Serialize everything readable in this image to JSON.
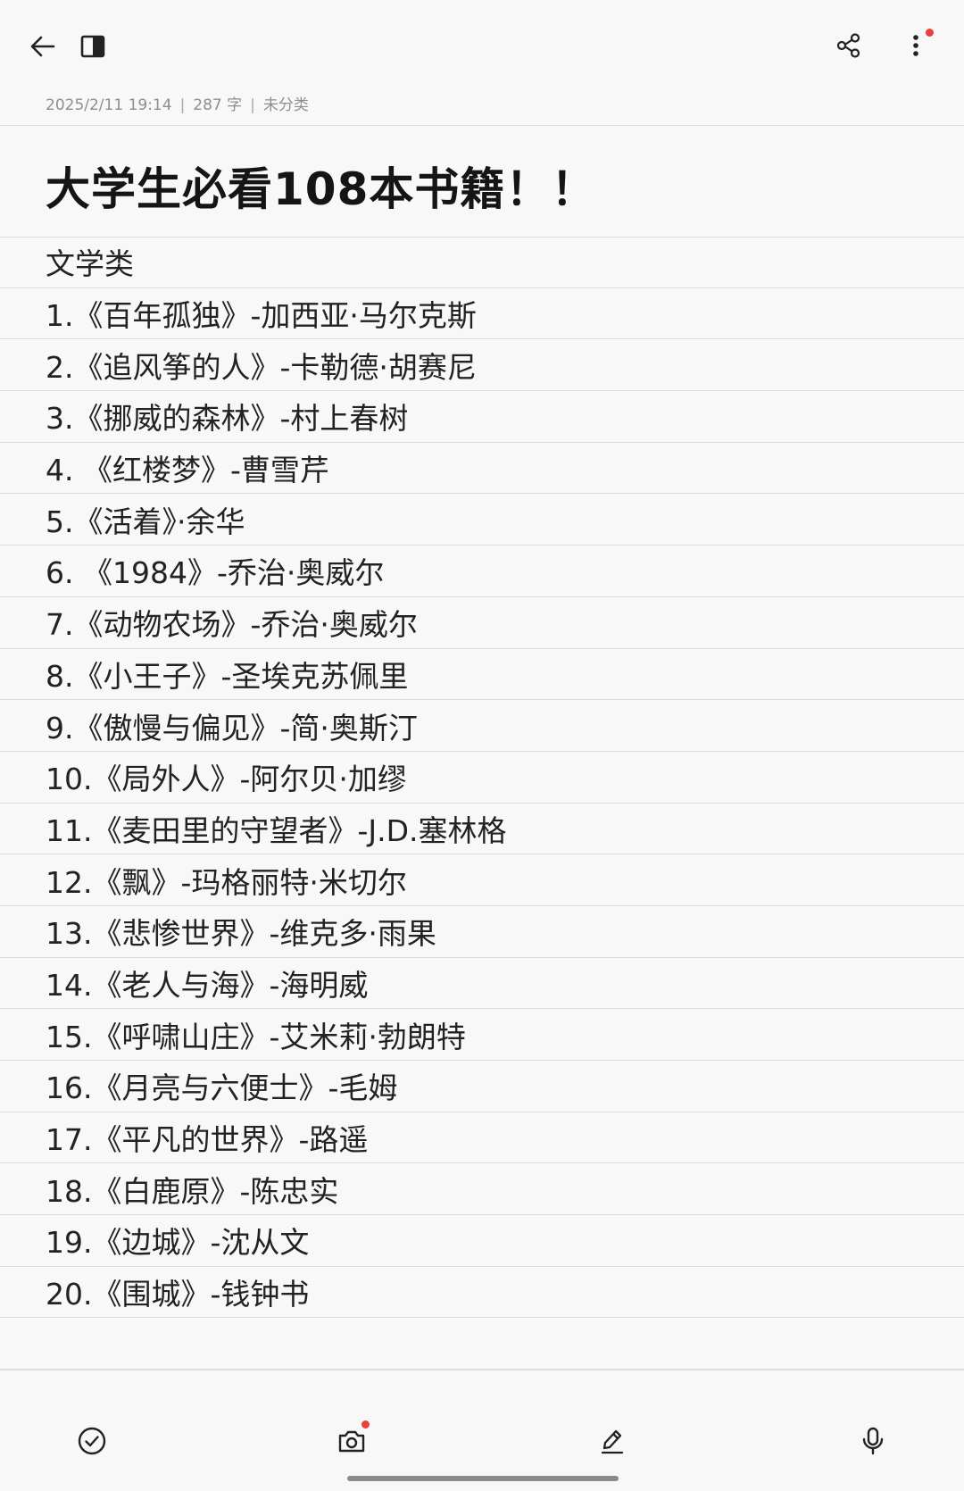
{
  "note": {
    "meta": {
      "datetime": "2025/2/11 19:14",
      "word_count": "287 字",
      "category": "未分类",
      "separator": "|"
    },
    "title": "大学生必看108本书籍！！",
    "lines": [
      "文学类",
      "1.《百年孤独》-加西亚·马尔克斯",
      "2.《追风筝的人》-卡勒德·胡赛尼",
      "3.《挪威的森林》-村上春树",
      "4. 《红楼梦》-曹雪芹",
      "5.《活着》·余华",
      "6. 《1984》-乔治·奥威尔",
      "7.《动物农场》-乔治·奥威尔",
      "8.《小王子》-圣埃克苏佩里",
      "9.《傲慢与偏见》-简·奥斯汀",
      "10.《局外人》-阿尔贝·加缪",
      "11.《麦田里的守望者》-J.D.塞林格",
      "12.《飘》-玛格丽特·米切尔",
      "13.《悲惨世界》-维克多·雨果",
      "14.《老人与海》-海明威",
      "15.《呼啸山庄》-艾米莉·勃朗特",
      "16.《月亮与六便士》-毛姆",
      "17.《平凡的世界》-路遥",
      "18.《白鹿原》-陈忠实",
      "19.《边城》-沈从文",
      "20.《围城》-钱钟书"
    ]
  },
  "icons": {
    "back": "arrow-left-icon",
    "panel": "side-panel-icon",
    "share": "share-icon",
    "more": "more-vertical-icon",
    "checklist": "check-circle-icon",
    "camera": "camera-icon",
    "draw": "pen-icon",
    "voice": "microphone-icon"
  },
  "colors": {
    "background": "#f8f8f8",
    "notification_dot": "#e8413a",
    "text": "#1c1c1c",
    "meta_text": "#8e8e8e"
  }
}
